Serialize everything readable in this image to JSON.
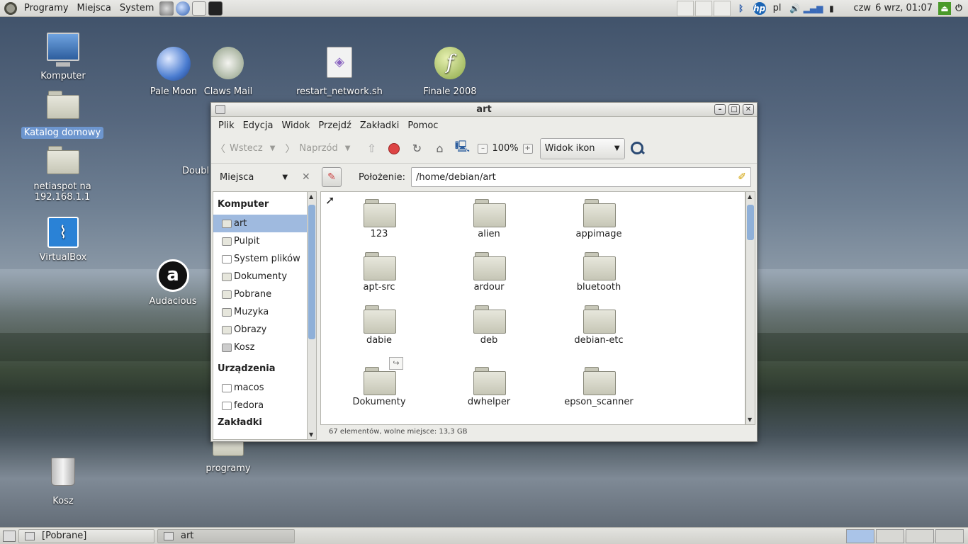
{
  "top_panel": {
    "menus": [
      "Programy",
      "Miejsca",
      "System"
    ],
    "keyboard_layout": "pl",
    "day": "czw",
    "datetime": "6 wrz, 01:07"
  },
  "desktop": {
    "icons": [
      {
        "label": "Komputer",
        "icon": "computer-icon"
      },
      {
        "label": "Katalog domowy",
        "icon": "home-folder-icon",
        "selected": true
      },
      {
        "label": "netiaspot na 192.168.1.1",
        "icon": "network-folder-icon"
      },
      {
        "label": "VirtualBox",
        "icon": "virtualbox-icon"
      },
      {
        "label": "Audacious",
        "icon": "audacious-icon"
      },
      {
        "label": "Kosz",
        "icon": "trash-icon"
      },
      {
        "label": "Pale Moon",
        "icon": "pale-moon-icon"
      },
      {
        "label": "Claws Mail",
        "icon": "claws-mail-icon"
      },
      {
        "label": "restart_network.sh",
        "icon": "script-file-icon"
      },
      {
        "label": "Finale 2008",
        "icon": "finale-icon"
      },
      {
        "label": "Doubl",
        "icon": "partial-icon"
      },
      {
        "label": "programy",
        "icon": "folder-icon"
      }
    ]
  },
  "window": {
    "title": "art",
    "menus": [
      "Plik",
      "Edycja",
      "Widok",
      "Przejdź",
      "Zakładki",
      "Pomoc"
    ],
    "toolbar": {
      "back": "Wstecz",
      "forward": "Naprzód",
      "zoom": "100%",
      "view_mode": "Widok ikon"
    },
    "sidebar": {
      "selector": "Miejsca",
      "sections": [
        {
          "heading": "Komputer",
          "items": [
            "art",
            "Pulpit",
            "System plików",
            "Dokumenty",
            "Pobrane",
            "Muzyka",
            "Obrazy",
            "Kosz"
          ]
        },
        {
          "heading": "Urządzenia",
          "items": [
            "macos",
            "fedora"
          ]
        },
        {
          "heading": "Zakładki",
          "items": []
        }
      ],
      "selected": "art"
    },
    "location": {
      "label": "Położenie:",
      "path": "/home/debian/art"
    },
    "files": [
      "123",
      "alien",
      "appimage",
      "apt-src",
      "ardour",
      "bluetooth",
      "dabie",
      "deb",
      "debian-etc",
      "Dokumenty",
      "dwhelper",
      "epson_scanner"
    ],
    "status": "67 elementów, wolne miejsce: 13,3 GB"
  },
  "taskbar": {
    "tasks": [
      "[Pobrane]",
      "art"
    ]
  }
}
